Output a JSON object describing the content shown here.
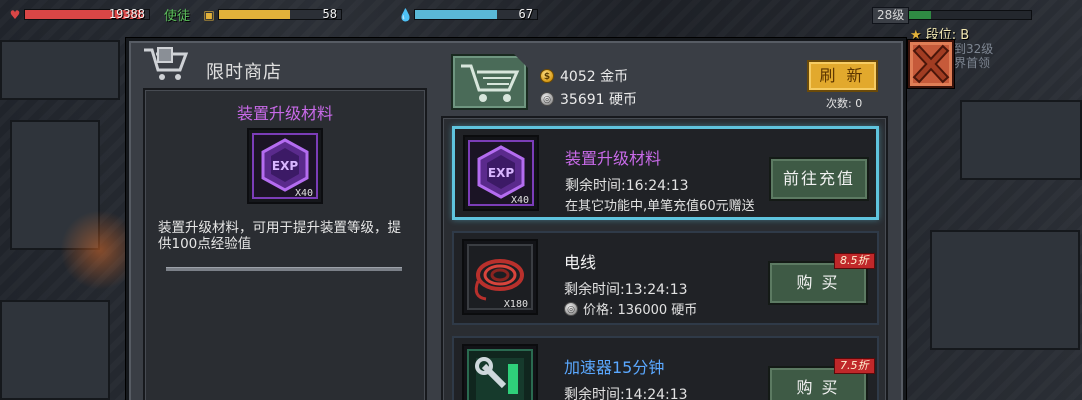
{
  "hud": {
    "hp": "19388",
    "partial_text": "使徒",
    "energy": "58",
    "water": "67",
    "hp_fill": 0.95,
    "energy_fill": 0.58,
    "water_fill": 0.67
  },
  "player": {
    "level": "28级",
    "rank": "段位: B",
    "side_line1": "到32级",
    "side_line2": "界首领"
  },
  "shop": {
    "title": "限时商店",
    "gold": "4052 金币",
    "silver": "35691 硬币",
    "refresh_label": "刷 新",
    "refresh_count": "次数: 0"
  },
  "detail": {
    "name": "装置升级材料",
    "qty": "X40",
    "description": "装置升级材料，可用于提升装置等级，提供100点经验值"
  },
  "items": [
    {
      "name": "装置升级材料",
      "qty": "X40",
      "time": "剩余时间:16:24:13",
      "extra": "在其它功能中,单笔充值60元赠送",
      "button": "前往充值",
      "discount": ""
    },
    {
      "name": "电线",
      "qty": "X180",
      "time": "剩余时间:13:24:13",
      "extra": "价格: 136000 硬币",
      "button": "购 买",
      "discount": "8.5折"
    },
    {
      "name": "加速器15分钟",
      "qty": "",
      "time": "剩余时间:14:24:13",
      "extra": "",
      "button": "购 买",
      "discount": "7.5折"
    }
  ],
  "colors": {
    "selected_border": "#5fc4de",
    "purple_title": "#c86ae8",
    "blue_title": "#5aa8ff",
    "hp": "#d94646",
    "energy": "#e2b23a",
    "water": "#5ab8d6"
  }
}
